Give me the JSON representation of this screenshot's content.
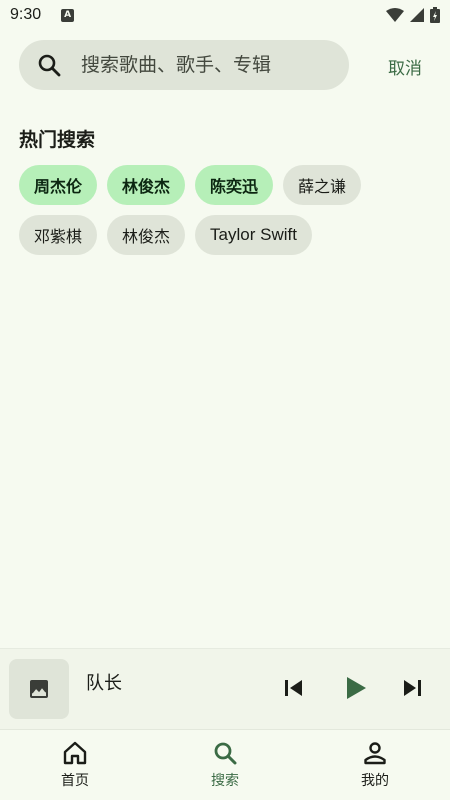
{
  "status_bar": {
    "time": "9:30",
    "notification_glyph": "A"
  },
  "search": {
    "placeholder": "搜索歌曲、歌手、专辑",
    "value": "",
    "cancel_label": "取消"
  },
  "hot_search": {
    "title": "热门搜索",
    "chips": [
      {
        "label": "周杰伦",
        "highlighted": true
      },
      {
        "label": "林俊杰",
        "highlighted": true
      },
      {
        "label": "陈奕迅",
        "highlighted": true
      },
      {
        "label": "薛之谦",
        "highlighted": false
      },
      {
        "label": "邓紫棋",
        "highlighted": false
      },
      {
        "label": "林俊杰",
        "highlighted": false
      },
      {
        "label": "Taylor Swift",
        "highlighted": false
      }
    ]
  },
  "player": {
    "track_title": "队长",
    "cover_icon": "image-placeholder-icon"
  },
  "nav": {
    "items": [
      {
        "label": "首页",
        "icon": "home-icon",
        "active": false
      },
      {
        "label": "搜索",
        "icon": "search-icon",
        "active": true
      },
      {
        "label": "我的",
        "icon": "person-icon",
        "active": false
      }
    ]
  },
  "colors": {
    "accent": "#3b6b45",
    "chip_hot_bg": "#b6efb8",
    "chip_bg": "#dfe4d8",
    "background": "#f6faf0"
  }
}
